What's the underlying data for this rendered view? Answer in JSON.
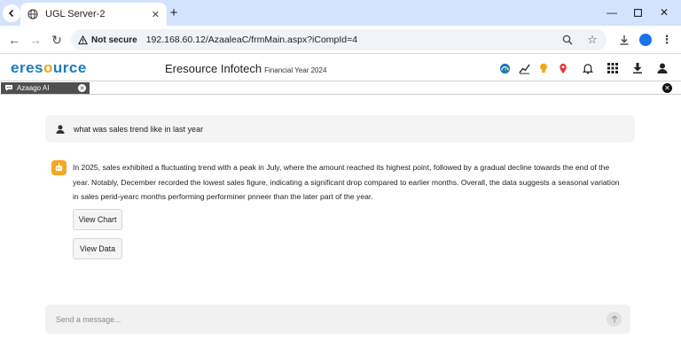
{
  "browser": {
    "tab_title": "UGL Server-2",
    "security_label": "Not secure",
    "url": "192.168.60.12/AzaaleaC/frmMain.aspx?iCompId=4"
  },
  "app": {
    "logo": {
      "part1": "eres",
      "part2": "o",
      "part3": "urce"
    },
    "title": "Eresource Infotech",
    "financial_year": "Financial Year 2024"
  },
  "panel": {
    "tab_label": "Azaago AI"
  },
  "chat": {
    "user_message": "what was sales trend like in last year",
    "bot_message": "In 2025, sales exhibited a fluctuating trend with a peak in July, where the amount reached its highest point, followed by a gradual decline towards the end of the year. Notably, December recorded the lowest sales figure, indicating a significant drop compared to earlier months. Overall, the data suggests a seasonal variation in sales perid-yearc months performing performiner pnneer than the later part of the year.",
    "view_chart_label": "View Chart",
    "view_data_label": "View Data",
    "composer_placeholder": "Send a message..."
  },
  "colors": {
    "logo_blue": "#1b7bbf",
    "logo_orange": "#f2a515",
    "bot_avatar": "#f5a623",
    "chrome_tabstrip": "#d3e3fd"
  }
}
